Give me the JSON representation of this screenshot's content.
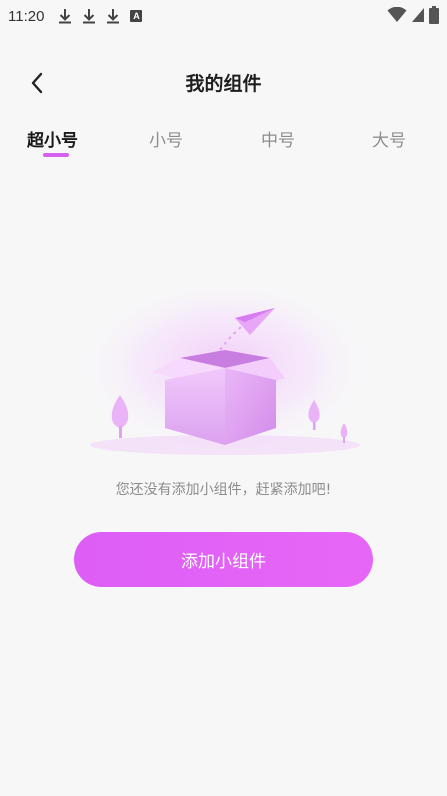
{
  "status_bar": {
    "time": "11:20",
    "left_icons": [
      "download-icon",
      "download-icon",
      "download-icon",
      "a-badge-icon"
    ],
    "right_icons": [
      "wifi-icon",
      "signal-icon",
      "battery-icon"
    ],
    "a_badge": "A"
  },
  "header": {
    "title": "我的组件",
    "back_icon": "chevron-left-icon"
  },
  "tabs": [
    {
      "label": "超小号",
      "active": true
    },
    {
      "label": "小号",
      "active": false
    },
    {
      "label": "中号",
      "active": false
    },
    {
      "label": "大号",
      "active": false
    }
  ],
  "empty_state": {
    "message": "您还没有添加小组件，赶紧添加吧!",
    "illustration": "open-box-with-paper-plane"
  },
  "add_button": {
    "label": "添加小组件"
  },
  "colors": {
    "accent": "#e063f6",
    "background": "#f7f7f8",
    "tab_inactive": "#8e8e8e",
    "tab_active": "#1a1a1a"
  }
}
